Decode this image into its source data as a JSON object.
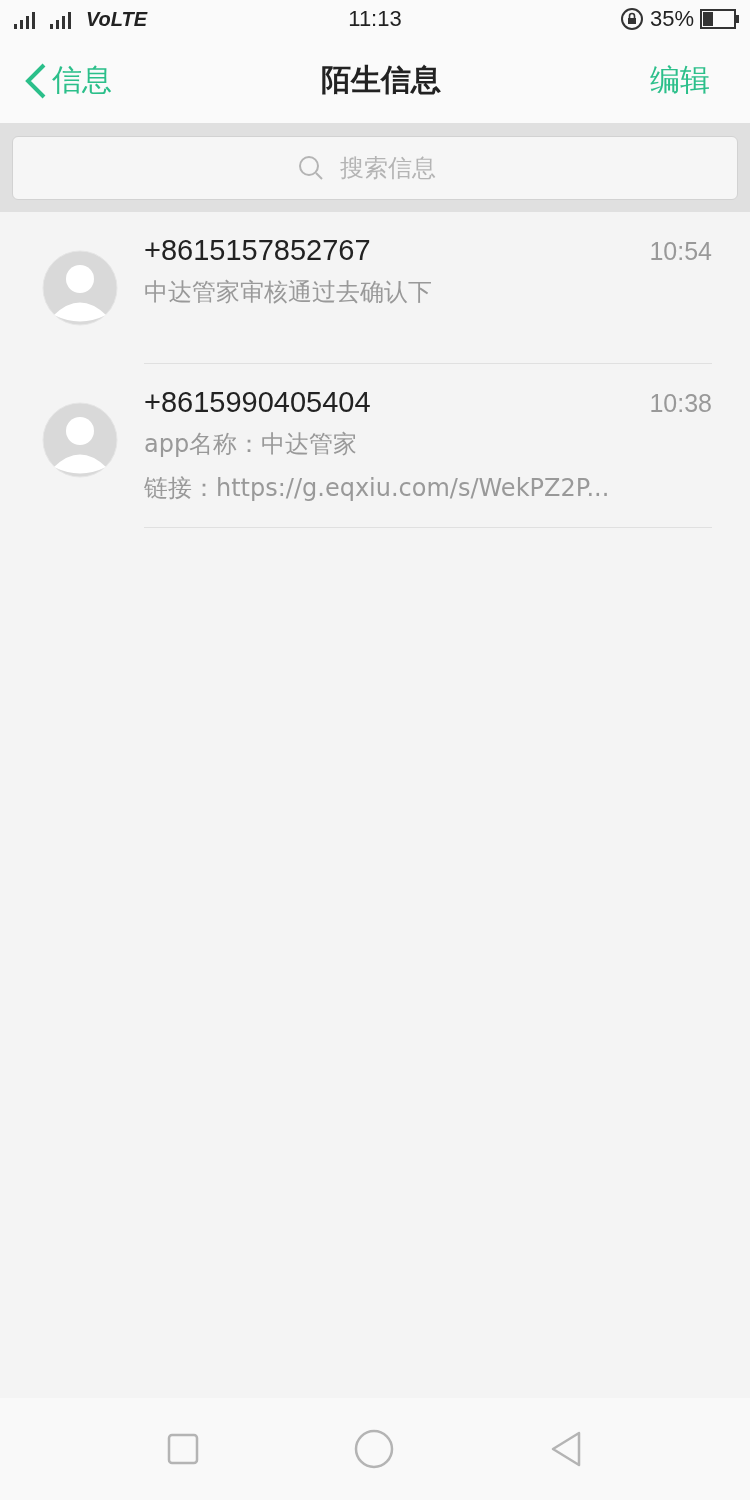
{
  "status_bar": {
    "network": "VoLTE",
    "time": "11:13",
    "battery": "35%"
  },
  "header": {
    "back": "信息",
    "title": "陌生信息",
    "action": "编辑"
  },
  "search": {
    "placeholder": "搜索信息"
  },
  "messages": [
    {
      "sender": "+8615157852767",
      "time": "10:54",
      "lines": [
        "中达管家审核通过去确认下"
      ]
    },
    {
      "sender": "+8615990405404",
      "time": "10:38",
      "lines": [
        "app名称：中达管家",
        "链接：https://g.eqxiu.com/s/WekPZ2P..."
      ]
    }
  ]
}
